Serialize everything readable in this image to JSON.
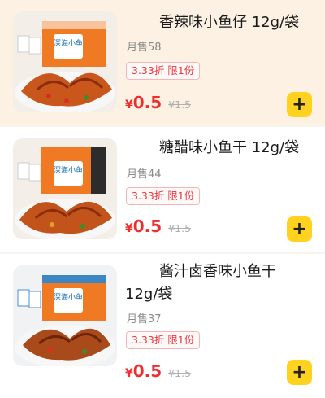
{
  "products": [
    {
      "title": "香辣味小鱼仔 12g/袋",
      "sales": "月售58",
      "promo": "3.33折 限1份",
      "currency": "¥",
      "price": "0.5",
      "original_price": "¥1.5",
      "add_icon": "plus-icon"
    },
    {
      "title": "糖醋味小鱼干 12g/袋",
      "sales": "月售44",
      "promo": "3.33折 限1份",
      "currency": "¥",
      "price": "0.5",
      "original_price": "¥1.5",
      "add_icon": "plus-icon"
    },
    {
      "title_line1": "酱汁卤香味小鱼干",
      "title_line2": "12g/袋",
      "sales": "月售37",
      "promo": "3.33折 限1份",
      "currency": "¥",
      "price": "0.5",
      "original_price": "¥1.5",
      "add_icon": "plus-icon"
    }
  ],
  "colors": {
    "price": "#ef2d2d",
    "promo": "#e4393c",
    "add_button": "#ffd21f",
    "highlight_row": "#fdf1e4"
  },
  "thumbnails": [
    {
      "box_text": "深海小鱼"
    },
    {
      "box_text": "深海小鱼"
    },
    {
      "box_text": "深海小鱼"
    }
  ]
}
